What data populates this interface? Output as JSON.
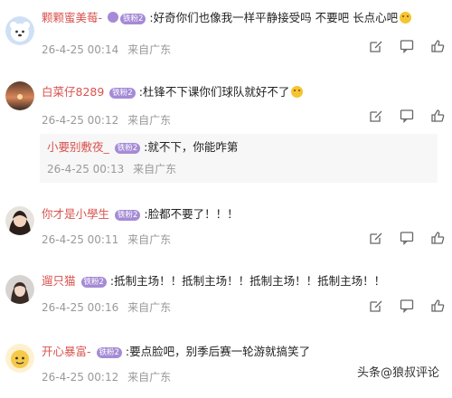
{
  "comments": [
    {
      "user": "颗颗蜜美莓-",
      "fan_badge": "铁粉2",
      "text": ":好奇你们也像我一样平静接受吗 不要吧 长点心吧",
      "date": "26-4-25 00:14",
      "location": "来自广东",
      "avatar": "bear-avatar"
    },
    {
      "user": "白菜仔8289",
      "fan_badge": "铁粉2",
      "text": ":杜锋不下课你们球队就好不了",
      "date": "26-4-25 00:12",
      "location": "来自广东",
      "avatar": "sunset-avatar",
      "reply": {
        "user": "小要别敷夜_",
        "fan_badge": "铁粉2",
        "text": ":就不下，你能咋第",
        "date": "26-4-25 00:13",
        "location": "来自广东"
      }
    },
    {
      "user": "你才是小學生",
      "fan_badge": "铁粉2",
      "text": ":脸都不要了！！！",
      "date": "26-4-25 00:11",
      "location": "来自广东",
      "avatar": "girl-avatar"
    },
    {
      "user": "遛只猫",
      "fan_badge": "铁粉2",
      "text": ":抵制主场！！抵制主场！！抵制主场！！抵制主场！！",
      "date": "26-4-25 00:16",
      "location": "来自广东",
      "avatar": "woman-avatar"
    },
    {
      "user": "开心暴富-",
      "fan_badge": "铁粉2",
      "text": ":要点脸吧，别季后赛一轮游就搞笑了",
      "date": "26-4-25 00:12",
      "location": "来自广东",
      "avatar": "cartoon-avatar"
    }
  ],
  "watermark": "头条@狼叔评论",
  "colors": {
    "username": "#d9534f",
    "badge": "#a58bd6",
    "meta": "#999999"
  },
  "action_icons": [
    "edit-icon",
    "comment-icon",
    "like-icon"
  ]
}
